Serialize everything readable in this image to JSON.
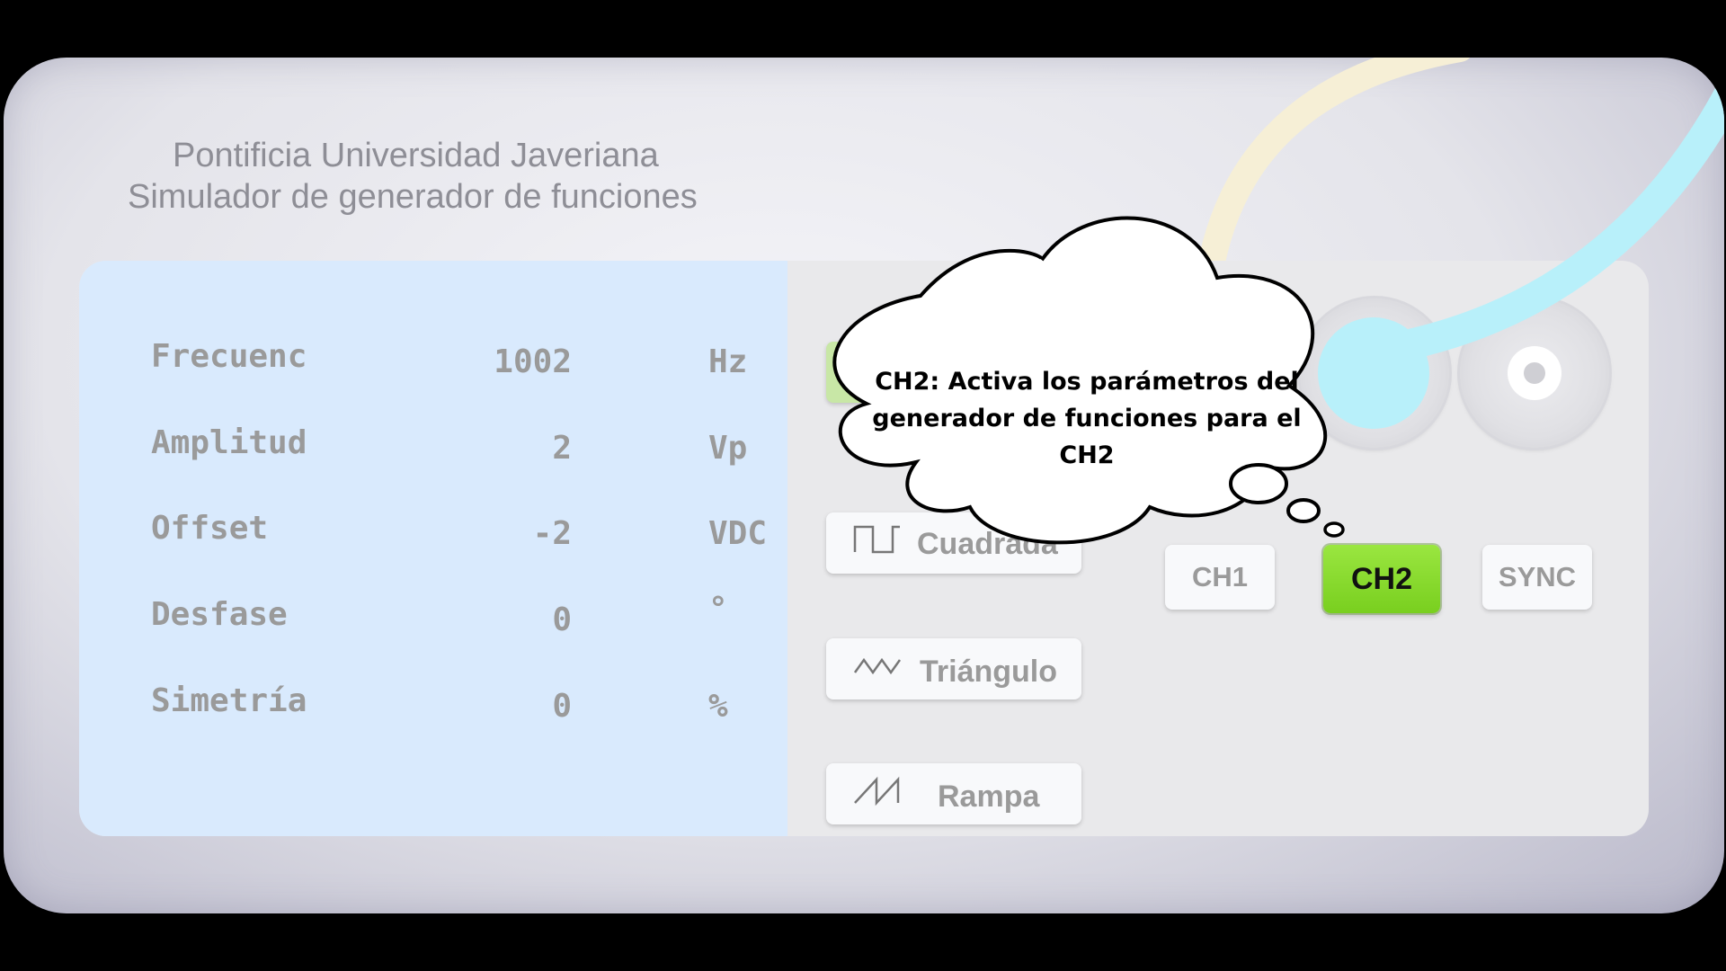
{
  "header": {
    "line1": "Pontificia Universidad Javeriana",
    "line2": "Simulador de generador de funciones"
  },
  "display": {
    "rows": [
      {
        "label": "Frecuenc",
        "value": "1002",
        "unit": "Hz"
      },
      {
        "label": "Amplitud",
        "value": "2",
        "unit": "Vp"
      },
      {
        "label": "Offset",
        "value": "-2",
        "unit": "VDC"
      },
      {
        "label": "Desfase",
        "value": "0",
        "unit": "°"
      },
      {
        "label": "Simetría",
        "value": "0",
        "unit": "%"
      }
    ]
  },
  "waveforms": [
    {
      "label": "Cuadrada",
      "icon": "square-wave-icon"
    },
    {
      "label": "Triángulo",
      "icon": "triangle-wave-icon"
    },
    {
      "label": "Rampa",
      "icon": "ramp-wave-icon"
    }
  ],
  "channels": {
    "ch1": "CH1",
    "ch2": "CH2",
    "sync": "SYNC",
    "active": "CH2",
    "active_color": "#8bdc2e"
  },
  "tooltip": {
    "text": "CH2: Activa los parámetros del generador de funciones para el CH2"
  },
  "colors": {
    "display_bg": "#d9eafd",
    "cable_cyan": "#b8f0fa",
    "cable_yellow": "#f6efd6"
  }
}
